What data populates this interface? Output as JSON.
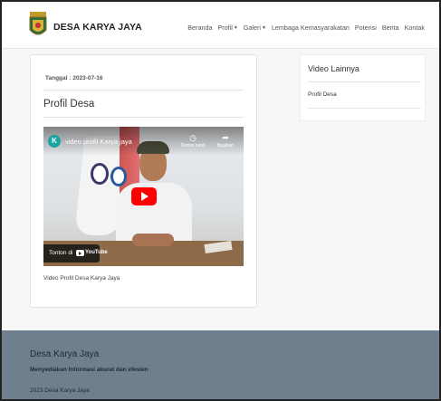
{
  "header": {
    "brand": "DESA KARYA JAYA",
    "logo_icon": "shield-emblem-icon",
    "nav": [
      {
        "label": "Beranda",
        "dropdown": false
      },
      {
        "label": "Profil",
        "dropdown": true
      },
      {
        "label": "Galeri",
        "dropdown": true
      },
      {
        "label": "Lembaga Kemasyarakatan",
        "dropdown": false
      },
      {
        "label": "Potensi",
        "dropdown": false
      },
      {
        "label": "Berita",
        "dropdown": false
      },
      {
        "label": "Kontak",
        "dropdown": false
      }
    ]
  },
  "main": {
    "date": "Tanggal : 2023-07-16",
    "title": "Profil Desa",
    "video": {
      "channel_initial": "K",
      "title": "video profil Karya jaya",
      "watch_later": "Tonton nanti",
      "share": "Bagikan",
      "watch_on": "Tonton di",
      "youtube": "YouTube"
    },
    "caption": "Video Profil Desa Karya Jaya"
  },
  "sidebar": {
    "title": "Video Lainnya",
    "link": "Profil Desa"
  },
  "footer": {
    "title": "Desa Karya Jaya",
    "subtitle": "Menyediakan Informasi akurat dan efesien",
    "copyright": "2023 Desa Karya Jaya"
  },
  "colors": {
    "footer_bg": "#6f7f8e",
    "youtube_red": "#ff0000",
    "avatar": "#1aa3a3"
  }
}
